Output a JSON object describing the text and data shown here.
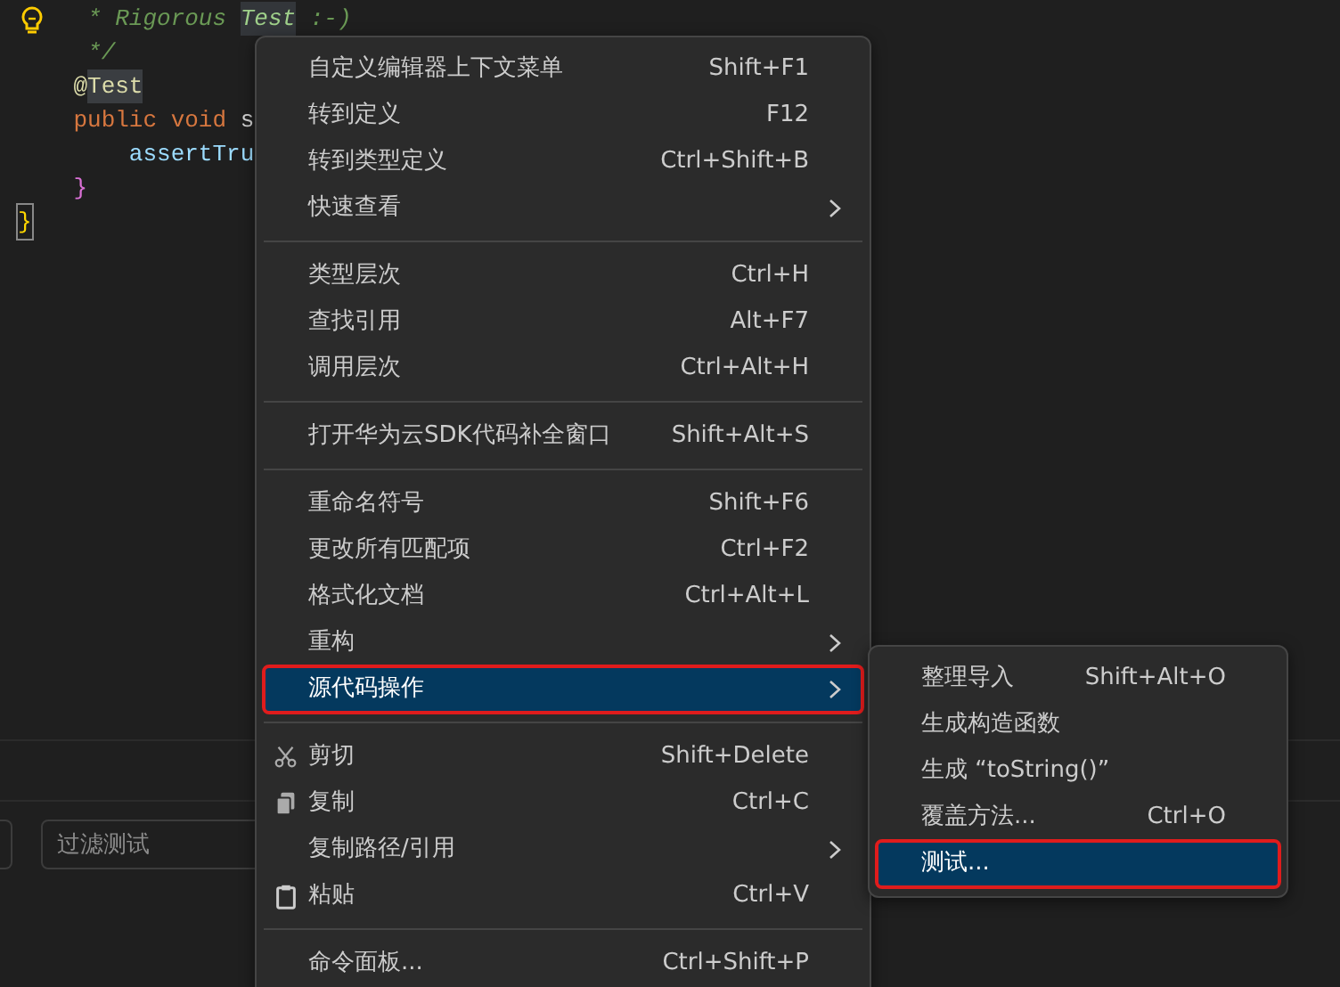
{
  "editor": {
    "lines": [
      {
        "segments": [
          {
            "text": "     * Rigorous ",
            "kind": "comment",
            "highlighted": false
          },
          {
            "text": "Test",
            "kind": "comment",
            "highlighted": true
          },
          {
            "text": " :-)",
            "kind": "comment",
            "highlighted": false
          }
        ]
      },
      {
        "segments": [
          {
            "text": "     */",
            "kind": "comment",
            "highlighted": false
          }
        ]
      },
      {
        "segments": [
          {
            "text": "    @",
            "kind": "annotation",
            "highlighted": false
          },
          {
            "text": "Test",
            "kind": "annotation",
            "highlighted": true
          }
        ]
      },
      {
        "segments": [
          {
            "text": "    public void",
            "kind": "keyword",
            "highlighted": false
          },
          {
            "text": " s",
            "kind": "plain",
            "highlighted": false
          }
        ]
      },
      {
        "segments": [
          {
            "text": "        assertTru",
            "kind": "method",
            "highlighted": false
          }
        ]
      },
      {
        "segments": [
          {
            "text": "    }",
            "kind": "brace",
            "highlighted": false
          }
        ]
      },
      {
        "segments": [
          {
            "text": "}",
            "kind": "outer-brace",
            "highlighted": true
          }
        ]
      }
    ]
  },
  "panel": {
    "filter": {
      "placeholder": "过滤测试"
    }
  },
  "context_menu": {
    "items": [
      {
        "kind": "item",
        "label": "自定义编辑器上下文菜单",
        "shortcut": "Shift+F1",
        "submenu": false,
        "selected": false,
        "annotated": false
      },
      {
        "kind": "item",
        "label": "转到定义",
        "shortcut": "F12",
        "submenu": false,
        "selected": false,
        "annotated": false
      },
      {
        "kind": "item",
        "label": "转到类型定义",
        "shortcut": "Ctrl+Shift+B",
        "submenu": false,
        "selected": false,
        "annotated": false
      },
      {
        "kind": "item",
        "label": "快速查看",
        "submenu": true,
        "selected": false,
        "annotated": false
      },
      {
        "kind": "separator"
      },
      {
        "kind": "item",
        "label": "类型层次",
        "shortcut": "Ctrl+H",
        "submenu": false,
        "selected": false,
        "annotated": false
      },
      {
        "kind": "item",
        "label": "查找引用",
        "shortcut": "Alt+F7",
        "submenu": false,
        "selected": false,
        "annotated": false
      },
      {
        "kind": "item",
        "label": "调用层次",
        "shortcut": "Ctrl+Alt+H",
        "submenu": false,
        "selected": false,
        "annotated": false
      },
      {
        "kind": "separator"
      },
      {
        "kind": "item",
        "label": "打开华为云SDK代码补全窗口",
        "shortcut": "Shift+Alt+S",
        "submenu": false,
        "selected": false,
        "annotated": false
      },
      {
        "kind": "separator"
      },
      {
        "kind": "item",
        "label": "重命名符号",
        "shortcut": "Shift+F6",
        "submenu": false,
        "selected": false,
        "annotated": false
      },
      {
        "kind": "item",
        "label": "更改所有匹配项",
        "shortcut": "Ctrl+F2",
        "submenu": false,
        "selected": false,
        "annotated": false
      },
      {
        "kind": "item",
        "label": "格式化文档",
        "shortcut": "Ctrl+Alt+L",
        "submenu": false,
        "selected": false,
        "annotated": false
      },
      {
        "kind": "item",
        "label": "重构",
        "submenu": true,
        "selected": false,
        "annotated": false
      },
      {
        "kind": "item",
        "label": "源代码操作",
        "submenu": true,
        "selected": true,
        "annotated": true
      },
      {
        "kind": "separator"
      },
      {
        "kind": "item",
        "label": "剪切",
        "shortcut": "Shift+Delete",
        "submenu": false,
        "selected": false,
        "annotated": false
      },
      {
        "kind": "item",
        "label": "复制",
        "shortcut": "Ctrl+C",
        "submenu": false,
        "selected": false,
        "annotated": false
      },
      {
        "kind": "item",
        "label": "复制路径/引用",
        "submenu": true,
        "selected": false,
        "annotated": false
      },
      {
        "kind": "item",
        "label": "粘贴",
        "shortcut": "Ctrl+V",
        "submenu": false,
        "selected": false,
        "annotated": false
      },
      {
        "kind": "separator"
      },
      {
        "kind": "item",
        "label": "命令面板...",
        "shortcut": "Ctrl+Shift+P",
        "submenu": false,
        "selected": false,
        "annotated": false
      }
    ]
  },
  "submenu": {
    "items": [
      {
        "kind": "item",
        "label": "整理导入",
        "shortcut": "Shift+Alt+O",
        "submenu": false,
        "selected": false,
        "annotated": false
      },
      {
        "kind": "item",
        "label": "生成构造函数",
        "submenu": false,
        "selected": false,
        "annotated": false
      },
      {
        "kind": "item",
        "label": "生成 “toString()”",
        "submenu": false,
        "selected": false,
        "annotated": false
      },
      {
        "kind": "item",
        "label": "覆盖方法...",
        "shortcut": "Ctrl+O",
        "submenu": false,
        "selected": false,
        "annotated": false
      },
      {
        "kind": "item",
        "label": "测试...",
        "submenu": false,
        "selected": true,
        "annotated": true
      }
    ]
  }
}
